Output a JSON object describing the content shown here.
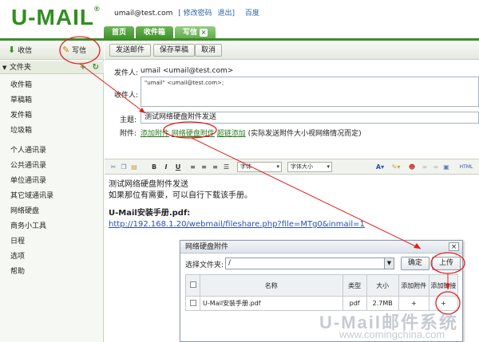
{
  "header": {
    "logo": "U-MAIL",
    "logo_mark": "®",
    "user_email": "umail@test.com",
    "links": [
      "[ 修改密码",
      "退出]",
      "百度"
    ],
    "tabs": [
      {
        "label": "首页"
      },
      {
        "label": "收件箱"
      },
      {
        "label": "写信",
        "close": "×"
      }
    ]
  },
  "sidebar": {
    "receive_label": "收信",
    "write_label": "写信",
    "folder_header": "文件夹",
    "folder_add": "+",
    "folder_refresh": "↻",
    "folders": [
      "收件箱",
      "草稿箱",
      "发件箱",
      "垃圾箱"
    ],
    "contacts": [
      "个人通讯录",
      "公共通讯录",
      "单位通讯录",
      "其它域通讯录",
      "网络硬盘",
      "商务小工具",
      "日程",
      "选项",
      "帮助"
    ]
  },
  "toolbar": {
    "send_label": "发送邮件",
    "save_label": "保存草稿",
    "cancel_label": "取消"
  },
  "compose": {
    "sender_label": "发件人:",
    "sender_value": "umail <umail@test.com>",
    "recipient_label": "收件人:",
    "recipient_value": "\"umail\" <umail@test.com>;",
    "subject_label": "主题:",
    "subject_value": "测试网络硬盘附件发送",
    "attach_label": "附件:",
    "attach_add": "添加附件",
    "attach_disk": "网络硬盘附件",
    "attach_link": "超链添加",
    "attach_note": "(实际发送附件大小视网络情况而定)"
  },
  "editor": {
    "font_select": "字体",
    "size_select": "字体大小",
    "html_label": "HTML"
  },
  "body": {
    "line1": "测试网络硬盘附件发送",
    "line2": "如果那位有需要，可以自行下载该手册。",
    "title": "U-Mail安装手册.pdf:",
    "link": "http://192.168.1.20/webmail/fileshare.php?file=MTg0&inmail=1"
  },
  "dialog": {
    "title": "网络硬盘附件",
    "close": "×",
    "folder_label": "选择文件夹:",
    "folder_value": "/",
    "confirm_label": "确定",
    "upload_label": "上传",
    "columns": [
      "名称",
      "类型",
      "大小",
      "添加附件",
      "添加链接"
    ],
    "rows": [
      {
        "name": "U-Mail安装手册.pdf",
        "type": "pdf",
        "size": "2.7MB",
        "add_attach": "+",
        "add_link": "+"
      }
    ]
  },
  "watermark": {
    "line1": "U-Mail邮件系统",
    "line2": "www.comingchina.com"
  },
  "colors": {
    "brand_green": "#2f8f1f",
    "tab_green": "#3d8e2a",
    "annotation_red": "#e02020",
    "link_blue": "#2a4fb0"
  }
}
